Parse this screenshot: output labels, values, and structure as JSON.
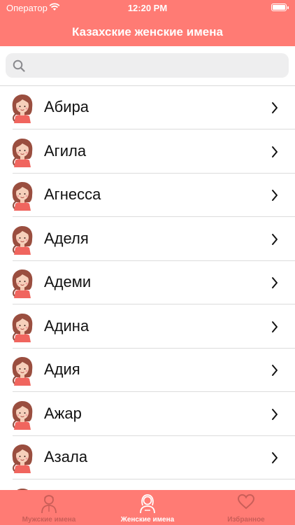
{
  "status_bar": {
    "carrier": "Оператор",
    "time": "12:20 PM"
  },
  "header": {
    "title": "Казахские женские имена"
  },
  "search": {
    "placeholder": ""
  },
  "names": [
    "Абира",
    "Агила",
    "Агнесса",
    "Аделя",
    "Адеми",
    "Адина",
    "Адия",
    "Ажар",
    "Азала",
    ""
  ],
  "tabs": [
    {
      "label": "Мужские имена",
      "icon": "man-icon",
      "active": false
    },
    {
      "label": "Женские имена",
      "icon": "woman-icon",
      "active": true
    },
    {
      "label": "Избранное",
      "icon": "heart-icon",
      "active": false
    }
  ],
  "colors": {
    "accent": "#ff7b74",
    "tab_inactive": "#c95e58"
  }
}
